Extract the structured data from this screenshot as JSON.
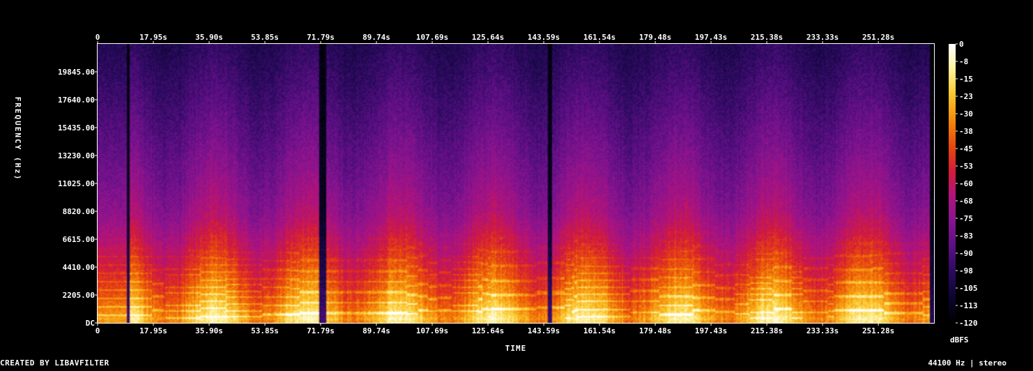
{
  "chart_data": {
    "type": "heatmap",
    "title": "",
    "xlabel": "TIME",
    "ylabel": "FREQUENCY (Hz)",
    "x_ticks": [
      "0",
      "17.95s",
      "35.90s",
      "53.85s",
      "71.79s",
      "89.74s",
      "107.69s",
      "125.64s",
      "143.59s",
      "161.54s",
      "179.48s",
      "197.43s",
      "215.38s",
      "233.33s",
      "251.28s"
    ],
    "x_tick_values": [
      0,
      17.95,
      35.9,
      53.85,
      71.79,
      89.74,
      107.69,
      125.64,
      143.59,
      161.54,
      179.48,
      197.43,
      215.38,
      233.33,
      251.28
    ],
    "xlim": [
      0,
      269.2
    ],
    "y_ticks": [
      "DC",
      "2205.00",
      "4410.00",
      "6615.00",
      "8820.00",
      "11025.00",
      "13230.00",
      "15435.00",
      "17640.00",
      "19845.00"
    ],
    "y_tick_values": [
      0,
      2205,
      4410,
      6615,
      8820,
      11025,
      13230,
      15435,
      17640,
      19845
    ],
    "ylim": [
      0,
      22050
    ],
    "colorbar": {
      "label": "dBFS",
      "ticks": [
        "0",
        "-8",
        "-15",
        "-23",
        "-30",
        "-38",
        "-45",
        "-53",
        "-60",
        "-68",
        "-75",
        "-83",
        "-90",
        "-98",
        "-105",
        "-113",
        "-120"
      ],
      "range": [
        -120,
        0
      ]
    },
    "colormap": [
      "#000000",
      "#0c0530",
      "#2a0a5e",
      "#5a0f82",
      "#86148f",
      "#b0137c",
      "#d41c38",
      "#e84a0c",
      "#f58a0a",
      "#fbc72b",
      "#fdf19a",
      "#ffffff"
    ],
    "quiet_segments": [
      {
        "t": [
          9.0,
          10.2
        ]
      },
      {
        "t": [
          71.0,
          73.5
        ]
      },
      {
        "t": [
          144.5,
          146.0
        ]
      }
    ],
    "active_end_time": 269.2,
    "grid": false
  },
  "footer": {
    "left": "CREATED BY LIBAVFILTER",
    "right": "44100 Hz | stereo"
  }
}
